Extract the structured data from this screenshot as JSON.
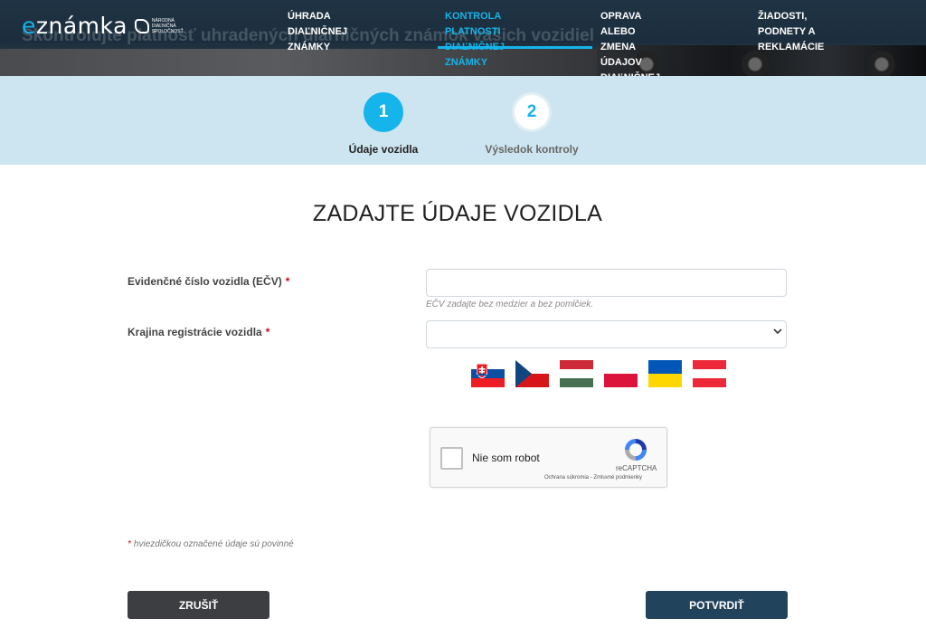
{
  "header": {
    "logo_prefix": "e",
    "logo_main": "známka",
    "logo_sub": "Národná diaľničná spoločnosť",
    "background_text": "Skontrolujte platnosť uhradených diaľničných známok vašich vozidiel",
    "nav": [
      {
        "line1": "Úhrada diaľničnej známky",
        "line2": ""
      },
      {
        "line1": "Kontrola platnosti",
        "line2": "diaľničnej známky"
      },
      {
        "line1": "Oprava alebo zmena",
        "line2": "údajov diaľničnej známky"
      },
      {
        "line1": "Žiadosti, podnety a",
        "line2": "reklamácie"
      }
    ],
    "accent_color": "#15b4ea"
  },
  "stepper": {
    "steps": [
      {
        "number": "1",
        "label": "Údaje vozidla"
      },
      {
        "number": "2",
        "label": "Výsledok kontroly"
      }
    ]
  },
  "form": {
    "title": "ZADAJTE ÚDAJE VOZIDLA",
    "ecv_label": "Evidenčné číslo vozidla (EČV)",
    "ecv_value": "",
    "ecv_hint": "EČV zadajte bez medzier a bez pomlčiek.",
    "country_label": "Krajina registrácie vozidla",
    "country_value": "",
    "required_mark": "*",
    "flags": [
      "Slovensko",
      "Česko",
      "Maďarsko",
      "Poľsko",
      "Ukrajina",
      "Rakúsko"
    ],
    "required_note": "hviezdičkou označené údaje sú povinné"
  },
  "captcha": {
    "label": "Nie som robot",
    "brand": "reCAPTCHA",
    "links": "Ochrana súkromia - Zmluvné podmienky"
  },
  "buttons": {
    "cancel": "Zrušiť",
    "confirm": "Potvrdiť"
  }
}
